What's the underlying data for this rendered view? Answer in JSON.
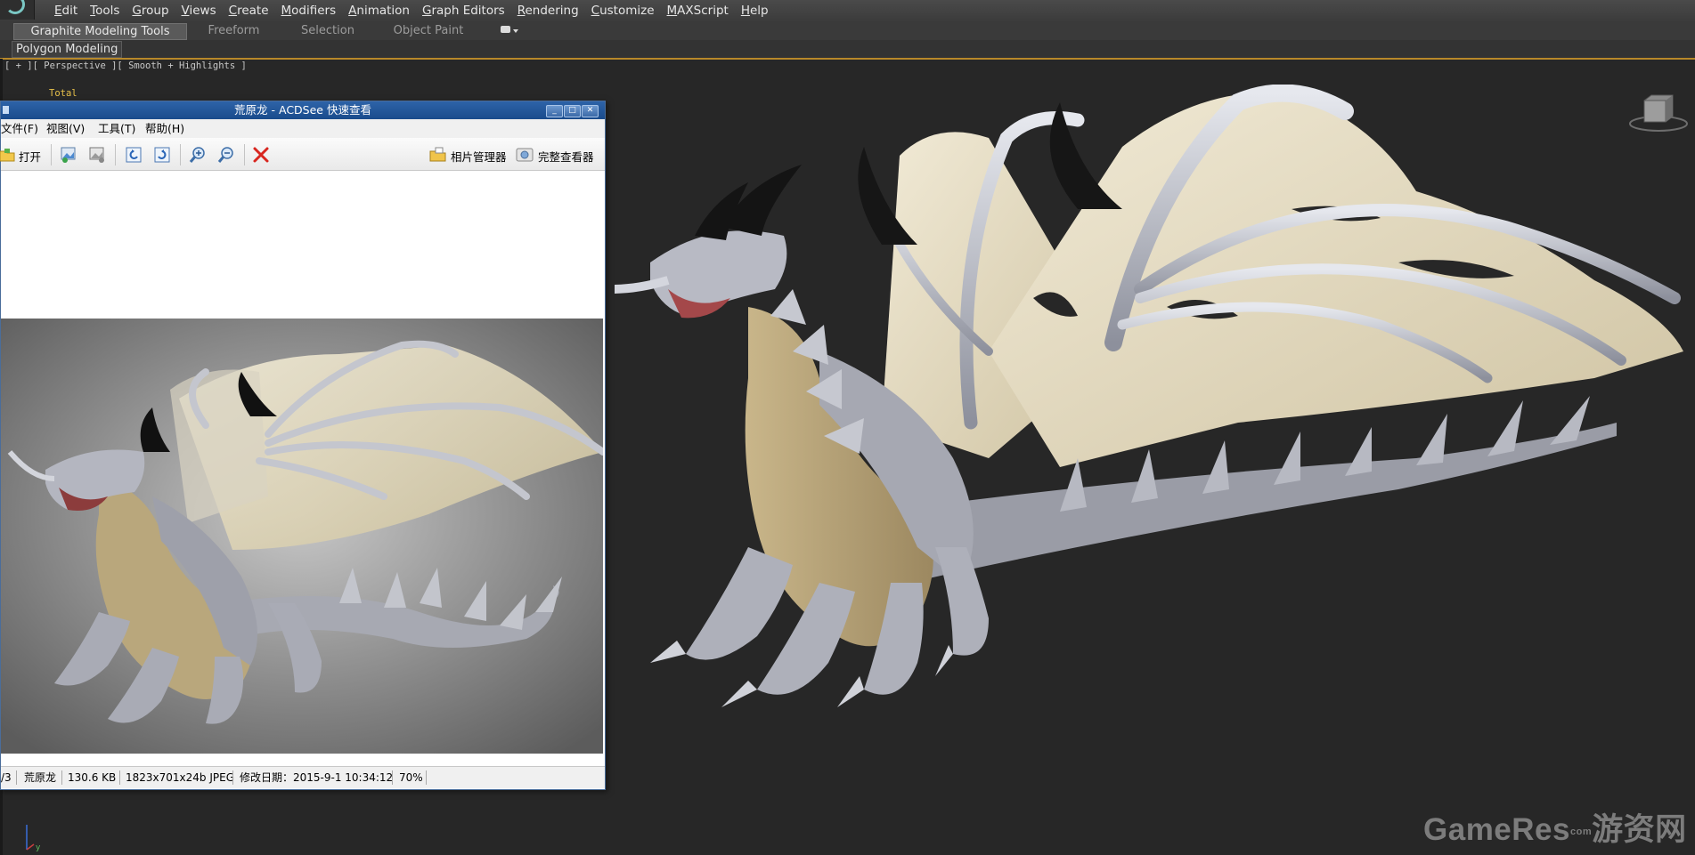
{
  "menubar": {
    "items": [
      "Edit",
      "Tools",
      "Group",
      "Views",
      "Create",
      "Modifiers",
      "Animation",
      "Graph Editors",
      "Rendering",
      "Customize",
      "MAXScript",
      "Help"
    ]
  },
  "ribbon": {
    "tabs": [
      "Graphite Modeling Tools",
      "Freeform",
      "Selection",
      "Object Paint"
    ],
    "active_tab": "Graphite Modeling Tools",
    "panel_label": "Polygon Modeling"
  },
  "viewport": {
    "label": "[ + ][ Perspective ][ Smooth + Highlights ]",
    "stats_label": "Total",
    "background_color": "#272727",
    "watermark": "GameRes游资网",
    "watermark_sub": "com"
  },
  "acdsee": {
    "title": "荒原龙 - ACDSee 快速查看",
    "menu": [
      "文件(F)",
      "视图(V)",
      "工具(T)",
      "帮助(H)"
    ],
    "toolbar": {
      "open_label": "打开",
      "photo_manager_label": "相片管理器",
      "full_viewer_label": "完整查看器",
      "icons": [
        "open-icon",
        "prev-image-icon",
        "next-image-icon",
        "rotate-left-icon",
        "rotate-right-icon",
        "zoom-in-icon",
        "zoom-out-icon",
        "delete-icon",
        "photo-manager-icon",
        "full-viewer-icon"
      ]
    },
    "status": {
      "index": "/3",
      "name": "荒原龙",
      "size": "130.6 KB",
      "dimensions": "1823x701x24b JPEG",
      "modified": "修改日期：2015-9-1 10:34:12",
      "zoom": "70%"
    },
    "window_buttons": [
      "minimize",
      "maximize",
      "close"
    ],
    "titlebar_color": "#1f5296"
  }
}
